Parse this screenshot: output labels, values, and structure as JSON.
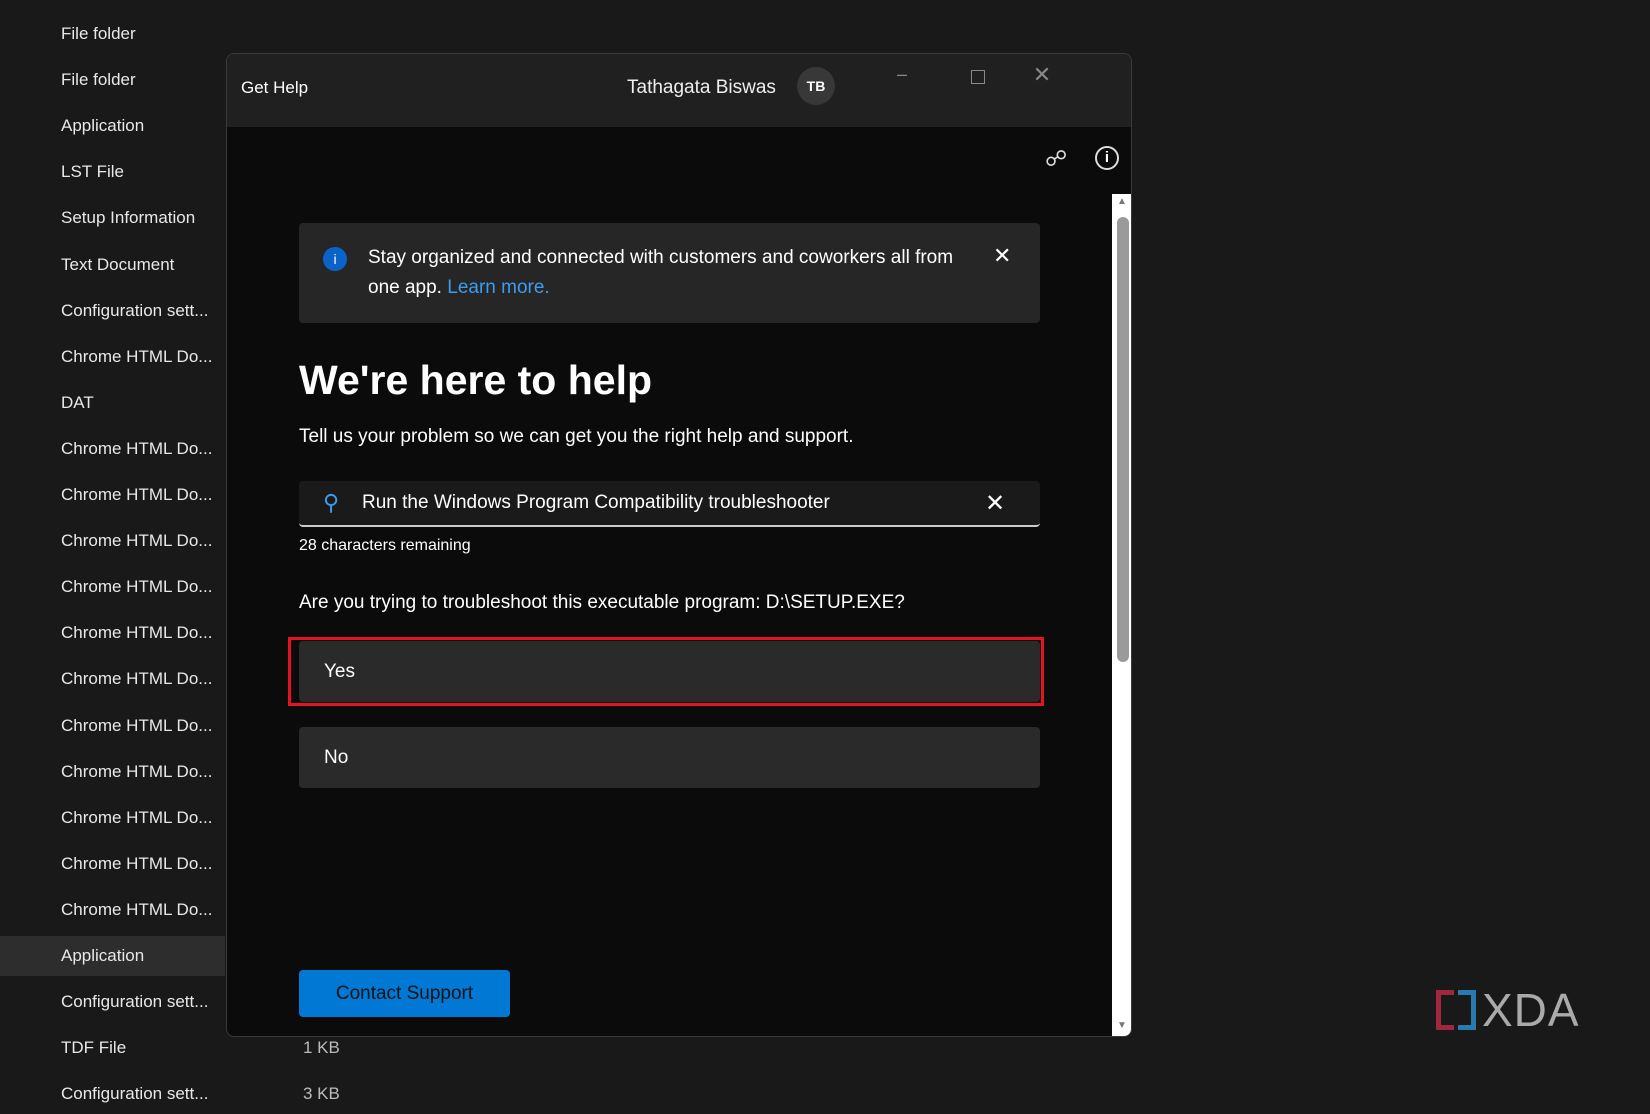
{
  "background_list": {
    "items": [
      "File folder",
      "File folder",
      "Application",
      "LST File",
      "Setup Information",
      "Text Document",
      "Configuration sett...",
      "Chrome HTML Do...",
      "DAT",
      "Chrome HTML Do...",
      "Chrome HTML Do...",
      "Chrome HTML Do...",
      "Chrome HTML Do...",
      "Chrome HTML Do...",
      "Chrome HTML Do...",
      "Chrome HTML Do...",
      "Chrome HTML Do...",
      "Chrome HTML Do...",
      "Chrome HTML Do...",
      "Chrome HTML Do...",
      "Application",
      "Configuration sett...",
      "TDF File",
      "Configuration sett..."
    ],
    "selected_index": 20,
    "sizes": [
      {
        "row": 22,
        "text": "1 KB"
      },
      {
        "row": 23,
        "text": "3 KB"
      }
    ]
  },
  "window": {
    "title": "Get Help",
    "user_name": "Tathagata Biswas",
    "avatar_initials": "TB"
  },
  "banner": {
    "text": "Stay organized and connected with customers and coworkers all from one app.",
    "link": "Learn more."
  },
  "main": {
    "heading": "We're here to help",
    "subtitle": "Tell us your problem so we can get you the right help and support.",
    "search_value": "Run the Windows Program Compatibility troubleshooter",
    "chars_remaining": "28 characters remaining",
    "question": "Are you trying to troubleshoot this executable program: D:\\SETUP.EXE?",
    "options": [
      "Yes",
      "No"
    ],
    "contact_button": "Contact Support"
  },
  "watermark": "XDA",
  "colors": {
    "accent": "#0078d4",
    "highlight": "#e81123",
    "link": "#3b9cf0"
  }
}
